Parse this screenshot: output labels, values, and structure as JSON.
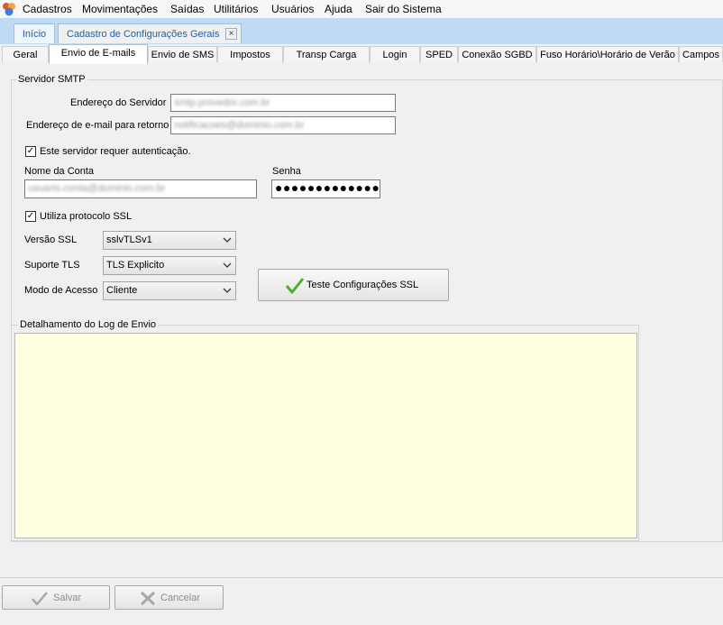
{
  "menu": {
    "items": [
      "Cadastros",
      "Movimentações",
      "Saídas",
      "Utilitários",
      "Usuários",
      "Ajuda",
      "Sair do Sistema"
    ]
  },
  "doc_tabs": {
    "home": "Início",
    "current": "Cadastro de Configurações Gerais",
    "close": "×"
  },
  "page_tabs": [
    "Geral",
    "Envio de E-mails",
    "Envio de SMS",
    "Impostos",
    "Transp Carga",
    "Login",
    "SPED",
    "Conexão SGBD",
    "Fuso Horário\\Horário de Verão",
    "Campos"
  ],
  "active_tab": "Envio de E-mails",
  "smtp": {
    "legend": "Servidor SMTP",
    "server_label": "Endereço do Servidor",
    "server_value": "smtp.provedor.com.br",
    "return_label": "Endereço de e-mail para retorno",
    "return_value": "notificacoes@dominio.com.br",
    "auth_check_label": "Este servidor requer autenticação.",
    "auth_checked": "✓",
    "account_label": "Nome da Conta",
    "account_value": "usuario.conta@dominio.com.br",
    "password_label": "Senha",
    "password_value": "●●●●●●●●●●●●●●",
    "ssl_check_label": "Utiliza protocolo SSL",
    "ssl_checked": "✓",
    "ssl_version_label": "Versão SSL",
    "ssl_version_value": "sslvTLSv1",
    "tls_label": "Suporte TLS",
    "tls_value": "TLS Explicito",
    "mode_label": "Modo de Acesso",
    "mode_value": "Cliente",
    "test_button": "Teste Configurações SSL"
  },
  "log": {
    "legend": "Detalhamento do Log de Envio"
  },
  "bottom": {
    "save": "Salvar",
    "cancel": "Cancelar"
  },
  "colors": {
    "tab_strip": "#bfdbf4",
    "log_background": "#ffffe1",
    "check_green": "#4caf2a"
  }
}
